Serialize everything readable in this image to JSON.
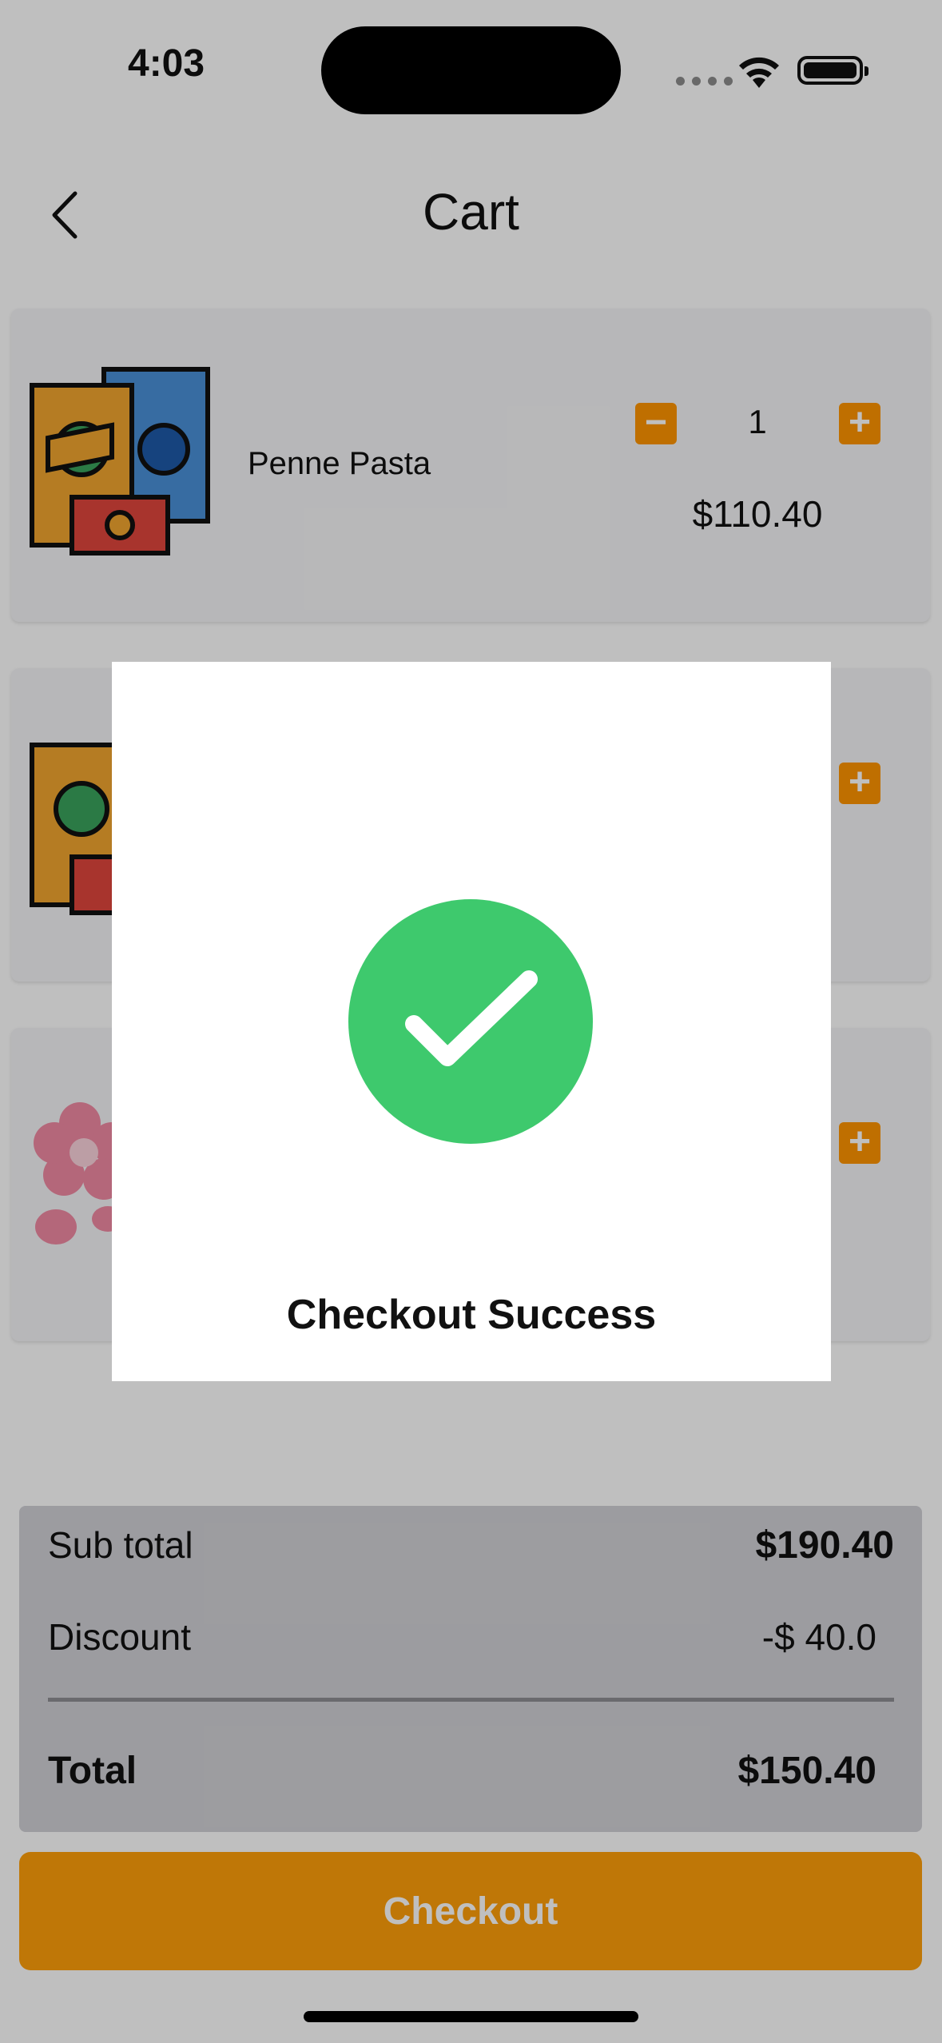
{
  "status_bar": {
    "time": "4:03"
  },
  "header": {
    "title": "Cart"
  },
  "items": [
    {
      "name": "Penne Pasta",
      "quantity": "1",
      "price": "$110.40",
      "image": "snack-packets-icon"
    },
    {
      "name": "",
      "quantity": "",
      "price": "",
      "image": "snack-packets-icon"
    },
    {
      "name": "",
      "quantity": "",
      "price": "",
      "image": "pink-flowers-icon"
    }
  ],
  "summary": {
    "subtotal_label": "Sub total",
    "subtotal_value": "$190.40",
    "discount_label": "Discount",
    "discount_value": "-$ 40.0",
    "total_label": "Total",
    "total_value": "$150.40"
  },
  "checkout_label": "Checkout",
  "modal": {
    "message": "Checkout Success"
  },
  "colors": {
    "accent": "#ff9500",
    "success": "#3ec96d"
  }
}
